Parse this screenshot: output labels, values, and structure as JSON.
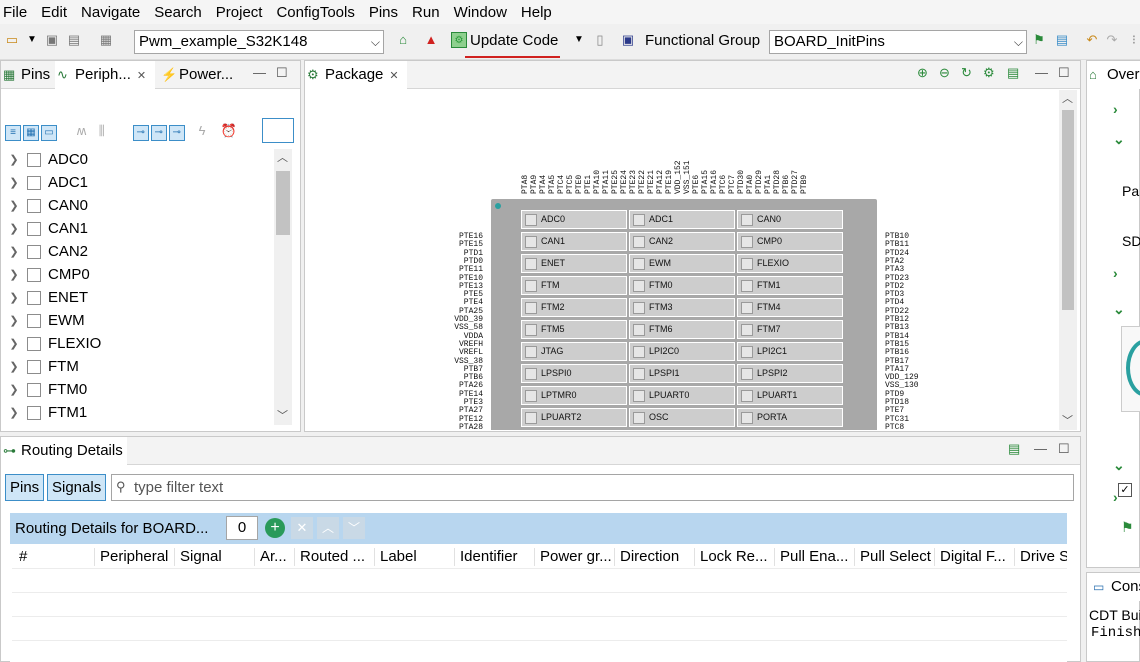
{
  "menu": [
    "File",
    "Edit",
    "Navigate",
    "Search",
    "Project",
    "ConfigTools",
    "Pins",
    "Run",
    "Window",
    "Help"
  ],
  "toolbar": {
    "project": "Pwm_example_S32K148",
    "update_code": "Update Code",
    "functional_group_label": "Functional Group",
    "functional_group": "BOARD_InitPins"
  },
  "tabs_left": {
    "pins": "Pins",
    "peripherals": "Periph...",
    "power": "Power..."
  },
  "periph_list": [
    "ADC0",
    "ADC1",
    "CAN0",
    "CAN1",
    "CAN2",
    "CMP0",
    "ENET",
    "EWM",
    "FLEXIO",
    "FTM",
    "FTM0",
    "FTM1"
  ],
  "package": {
    "tab": "Package",
    "top_pins": [
      "PTA8",
      "PTA9",
      "PTA4",
      "PTA5",
      "PTC4",
      "PTC5",
      "PTE0",
      "PTE1",
      "PTA10",
      "PTA11",
      "PTE25",
      "PTE24",
      "PTE23",
      "PTE22",
      "PTE21",
      "PTA12",
      "PTE19",
      "VDD_152",
      "VSS_151",
      "PTE6",
      "PTA15",
      "PTA16",
      "PTC6",
      "PTC7",
      "PTD30",
      "PTA0",
      "PTD29",
      "PTA1",
      "PTD28",
      "PTB6",
      "PTD27",
      "PTB9"
    ],
    "left_pins": [
      "PTE16",
      "PTE15",
      "PTD1",
      "PTD0",
      "PTE11",
      "PTE10",
      "PTE13",
      "PTE5",
      "PTE4",
      "PTA25",
      "VDD_39",
      "VSS_58",
      "VDDA",
      "VREFH",
      "VREFL",
      "VSS_38",
      "PTB7",
      "PTB6",
      "PTA26",
      "PTE14",
      "PTE3",
      "PTA27",
      "PTE12",
      "PTA28"
    ],
    "right_pins": [
      "PTB10",
      "PTB11",
      "PTD24",
      "PTA2",
      "PTA3",
      "PTD23",
      "PTD2",
      "PTD3",
      "PTD4",
      "PTD22",
      "PTB12",
      "PTB13",
      "PTB14",
      "PTB15",
      "PTB16",
      "PTB17",
      "PTA17",
      "VDD_129",
      "VSS_130",
      "PTD9",
      "PTD18",
      "PTE7",
      "PTC31",
      "PTC8"
    ],
    "cells": [
      [
        "ADC0",
        "ADC1",
        "CAN0"
      ],
      [
        "CAN1",
        "CAN2",
        "CMP0"
      ],
      [
        "ENET",
        "EWM",
        "FLEXIO"
      ],
      [
        "FTM",
        "FTM0",
        "FTM1"
      ],
      [
        "FTM2",
        "FTM3",
        "FTM4"
      ],
      [
        "FTM5",
        "FTM6",
        "FTM7"
      ],
      [
        "JTAG",
        "LPI2C0",
        "LPI2C1"
      ],
      [
        "LPSPI0",
        "LPSPI1",
        "LPSPI2"
      ],
      [
        "LPTMR0",
        "LPUART0",
        "LPUART1"
      ],
      [
        "LPUART2",
        "OSC",
        "PORTA"
      ]
    ]
  },
  "right_panel": {
    "tab": "Over",
    "rows": [
      "Pa",
      "SD"
    ],
    "console_tab": "Cons",
    "console_line1": "CDT Bui",
    "console_line2": "Finish"
  },
  "routing": {
    "tab": "Routing Details",
    "pins_btn": "Pins",
    "signals_btn": "Signals",
    "filter_placeholder": "type filter text",
    "table_title": "Routing Details for BOARD...",
    "count": "0",
    "columns": [
      "#",
      "Peripheral",
      "Signal",
      "Ar...",
      "Routed ...",
      "Label",
      "Identifier",
      "Power gr...",
      "Direction",
      "Lock Re...",
      "Pull Ena...",
      "Pull Select",
      "Digital F...",
      "Drive S"
    ]
  },
  "colors": {
    "accent": "#3c8ec8",
    "selected_bg": "#cfe6f7",
    "chip": "#a8a8a8",
    "error": "#d0211f"
  }
}
